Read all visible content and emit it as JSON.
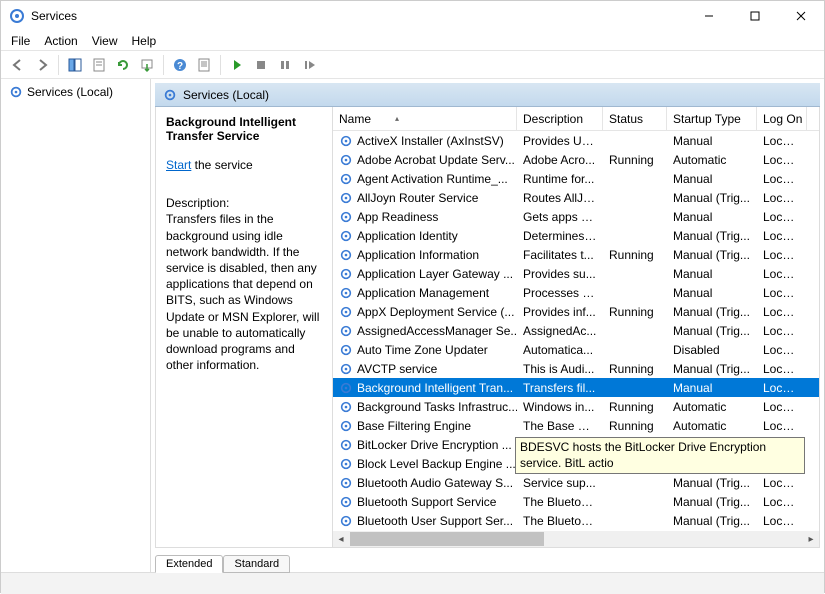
{
  "window": {
    "title": "Services"
  },
  "menu": {
    "file": "File",
    "action": "Action",
    "view": "View",
    "help": "Help"
  },
  "nav": {
    "label": "Services (Local)"
  },
  "header": {
    "label": "Services (Local)"
  },
  "detail": {
    "title": "Background Intelligent Transfer Service",
    "start_link": "Start",
    "start_suffix": " the service",
    "desc_label": "Description:",
    "description": "Transfers files in the background using idle network bandwidth. If the service is disabled, then any applications that depend on BITS, such as Windows Update or MSN Explorer, will be unable to automatically download programs and other information."
  },
  "columns": {
    "name": "Name",
    "description": "Description",
    "status": "Status",
    "startup": "Startup Type",
    "logon": "Log On"
  },
  "tooltip": "BDESVC hosts the BitLocker Drive Encryption service. BitL actio",
  "tabs": {
    "extended": "Extended",
    "standard": "Standard"
  },
  "services": [
    {
      "name": "ActiveX Installer (AxInstSV)",
      "desc": "Provides Us...",
      "status": "",
      "startup": "Manual",
      "logon": "Local Sy",
      "sel": false
    },
    {
      "name": "Adobe Acrobat Update Serv...",
      "desc": "Adobe Acro...",
      "status": "Running",
      "startup": "Automatic",
      "logon": "Local Sy",
      "sel": false
    },
    {
      "name": "Agent Activation Runtime_...",
      "desc": "Runtime for...",
      "status": "",
      "startup": "Manual",
      "logon": "Local Sy",
      "sel": false
    },
    {
      "name": "AllJoyn Router Service",
      "desc": "Routes AllJo...",
      "status": "",
      "startup": "Manual (Trig...",
      "logon": "Local Se",
      "sel": false
    },
    {
      "name": "App Readiness",
      "desc": "Gets apps re...",
      "status": "",
      "startup": "Manual",
      "logon": "Local Sy",
      "sel": false
    },
    {
      "name": "Application Identity",
      "desc": "Determines ...",
      "status": "",
      "startup": "Manual (Trig...",
      "logon": "Local Se",
      "sel": false
    },
    {
      "name": "Application Information",
      "desc": "Facilitates t...",
      "status": "Running",
      "startup": "Manual (Trig...",
      "logon": "Local Sy",
      "sel": false
    },
    {
      "name": "Application Layer Gateway ...",
      "desc": "Provides su...",
      "status": "",
      "startup": "Manual",
      "logon": "Local Se",
      "sel": false
    },
    {
      "name": "Application Management",
      "desc": "Processes in...",
      "status": "",
      "startup": "Manual",
      "logon": "Local Sy",
      "sel": false
    },
    {
      "name": "AppX Deployment Service (...",
      "desc": "Provides inf...",
      "status": "Running",
      "startup": "Manual (Trig...",
      "logon": "Local Sy",
      "sel": false
    },
    {
      "name": "AssignedAccessManager Se...",
      "desc": "AssignedAc...",
      "status": "",
      "startup": "Manual (Trig...",
      "logon": "Local Sy",
      "sel": false
    },
    {
      "name": "Auto Time Zone Updater",
      "desc": "Automatica...",
      "status": "",
      "startup": "Disabled",
      "logon": "Local Se",
      "sel": false
    },
    {
      "name": "AVCTP service",
      "desc": "This is Audi...",
      "status": "Running",
      "startup": "Manual (Trig...",
      "logon": "Local Se",
      "sel": false
    },
    {
      "name": "Background Intelligent Tran...",
      "desc": "Transfers fil...",
      "status": "",
      "startup": "Manual",
      "logon": "Local Sy",
      "sel": true
    },
    {
      "name": "Background Tasks Infrastruc...",
      "desc": "Windows in...",
      "status": "Running",
      "startup": "Automatic",
      "logon": "Local Sy",
      "sel": false
    },
    {
      "name": "Base Filtering Engine",
      "desc": "The Base Fil...",
      "status": "Running",
      "startup": "Automatic",
      "logon": "Local Se",
      "sel": false
    },
    {
      "name": "BitLocker Drive Encryption ...",
      "desc": "",
      "status": "",
      "startup": "",
      "logon": "",
      "sel": false
    },
    {
      "name": "Block Level Backup Engine ...",
      "desc": "",
      "status": "",
      "startup": "",
      "logon": "",
      "sel": false
    },
    {
      "name": "Bluetooth Audio Gateway S...",
      "desc": "Service sup...",
      "status": "",
      "startup": "Manual (Trig...",
      "logon": "Local Se",
      "sel": false
    },
    {
      "name": "Bluetooth Support Service",
      "desc": "The Bluetoo...",
      "status": "",
      "startup": "Manual (Trig...",
      "logon": "Local Se",
      "sel": false
    },
    {
      "name": "Bluetooth User Support Ser...",
      "desc": "The Bluetoo...",
      "status": "",
      "startup": "Manual (Trig...",
      "logon": "Local Sy",
      "sel": false
    }
  ]
}
